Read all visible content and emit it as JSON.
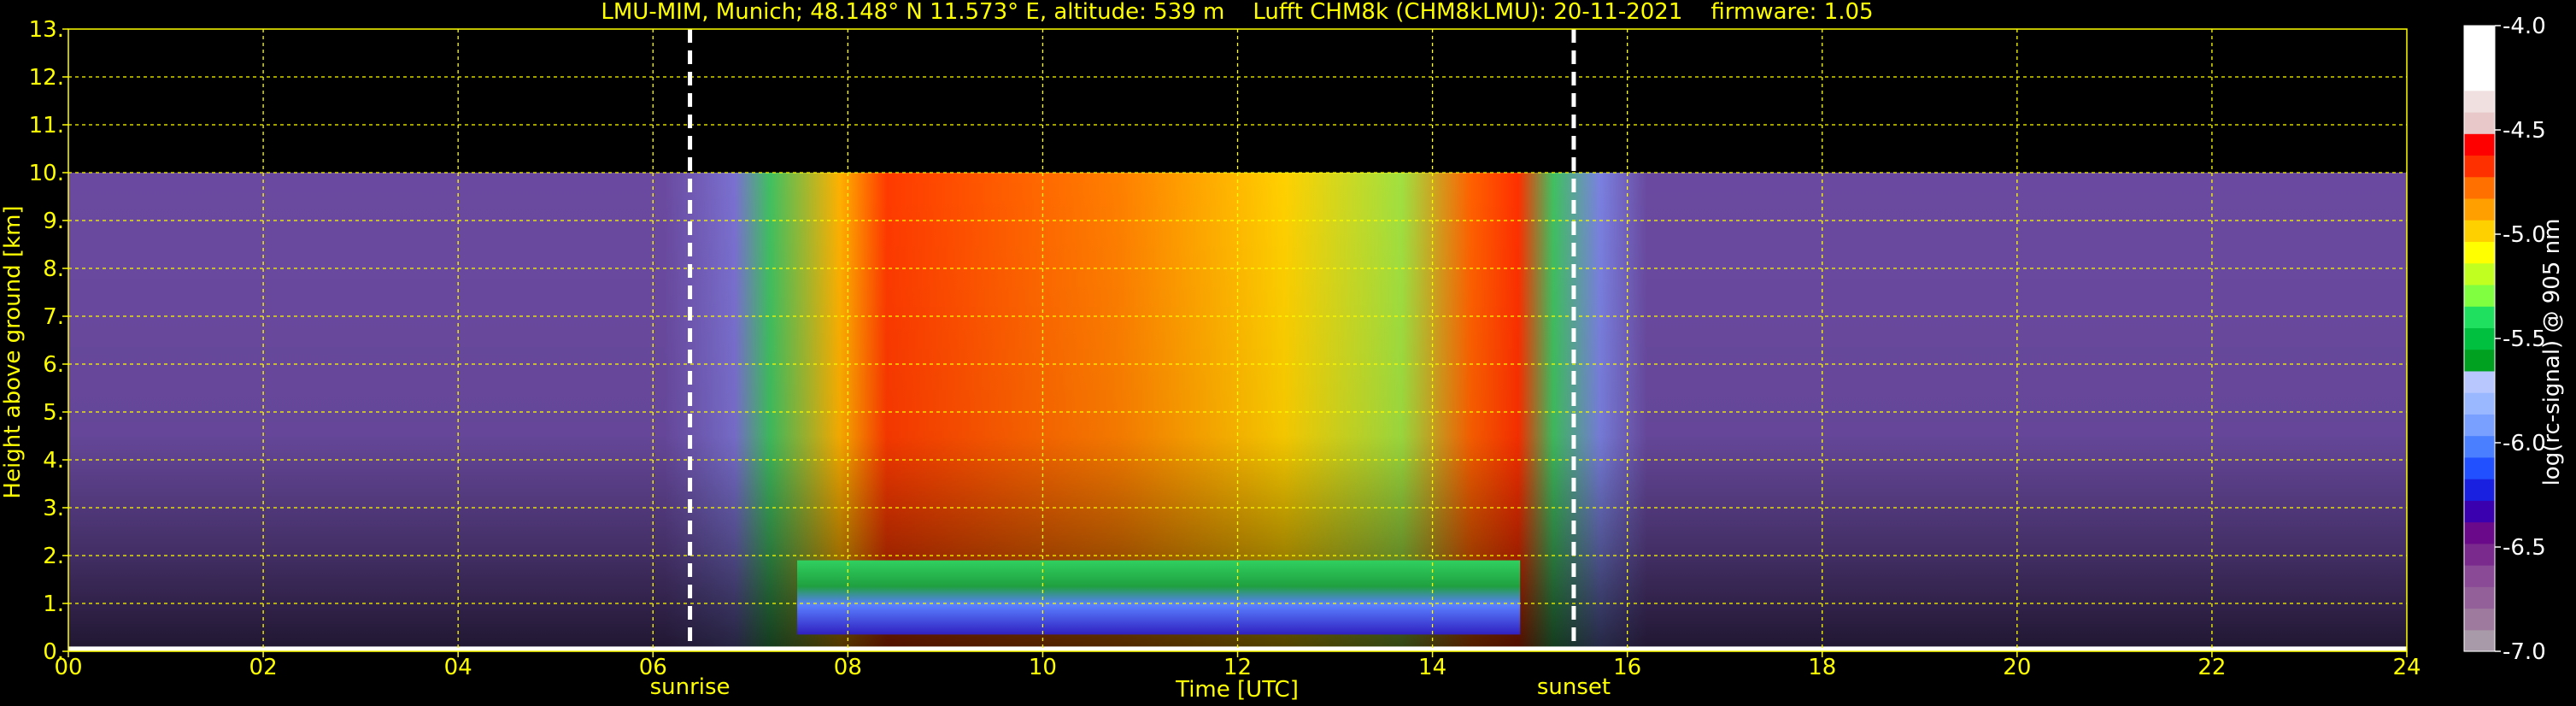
{
  "chart_data": {
    "type": "heatmap",
    "title": "LMU-MIM, Munich; 48.148° N 11.573° E, altitude: 539 m    Lufft CHM8k (CHM8kLMU): 20-11-2021    firmware: 1.05",
    "xlabel": "Time [UTC]",
    "ylabel": "Height above ground [km]",
    "xlim": [
      0,
      24
    ],
    "ylim": [
      0,
      13
    ],
    "x_ticks": [
      "00",
      "02",
      "04",
      "06",
      "08",
      "10",
      "12",
      "14",
      "16",
      "18",
      "20",
      "22",
      "24"
    ],
    "y_ticks": [
      "0.",
      "1.",
      "2.",
      "3.",
      "4.",
      "5.",
      "6.",
      "7.",
      "8.",
      "9.",
      "10.",
      "11.",
      "12.",
      "13."
    ],
    "grid": true,
    "grid_color": "#ffff00",
    "data_top_km": 10,
    "markers": [
      {
        "label": "sunrise",
        "time_utc": 6.38
      },
      {
        "label": "sunset",
        "time_utc": 15.45
      }
    ],
    "colorbar": {
      "label": "log(rc-signal) @ 905 nm",
      "range": [
        -7.0,
        -4.0
      ],
      "ticks": [
        "-4.0",
        "-4.5",
        "-5.0",
        "-5.5",
        "-6.0",
        "-6.5",
        "-7.0"
      ],
      "colors": [
        "#a89aa8",
        "#9e7a9e",
        "#94609a",
        "#8a4a96",
        "#7a2a8c",
        "#6a0a8a",
        "#3a00b0",
        "#1a20e0",
        "#2050ff",
        "#4a80ff",
        "#7aa0ff",
        "#9ab8ff",
        "#b8c8ff",
        "#00a020",
        "#00c040",
        "#20e060",
        "#80ff40",
        "#c0ff20",
        "#ffff00",
        "#ffd000",
        "#ffa000",
        "#ff7000",
        "#ff3000",
        "#ff0000",
        "#e8c8c8",
        "#f0e0e0",
        "#ffffff",
        "#ffffff",
        "#ffffff"
      ]
    }
  }
}
